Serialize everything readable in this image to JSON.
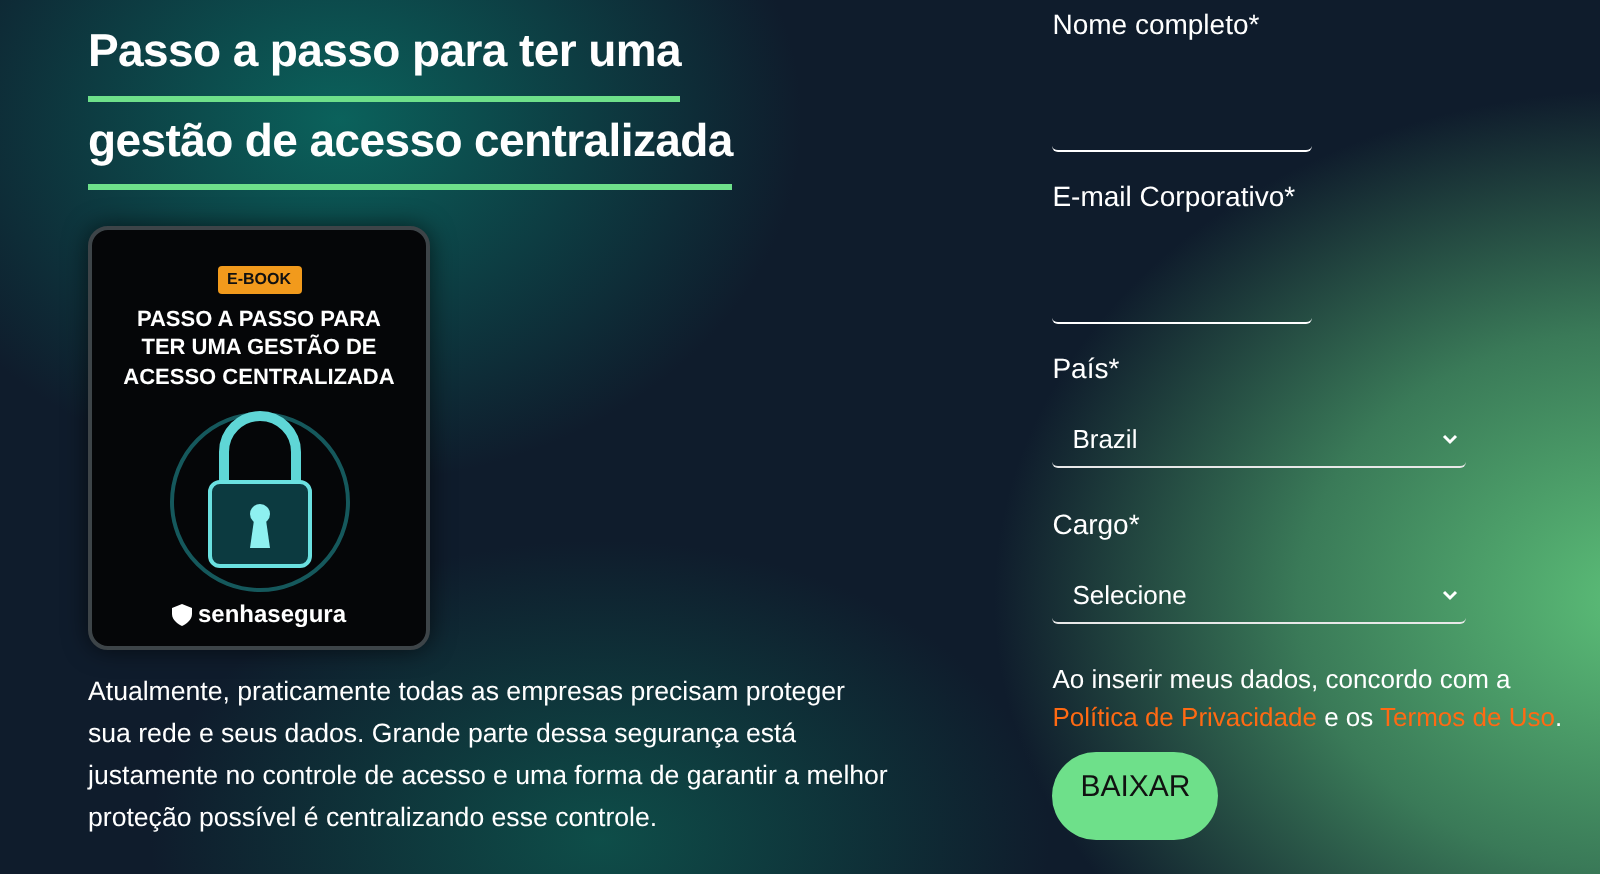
{
  "heading": {
    "lines": [
      "Passo a passo para ter uma",
      "gestão de acesso centralizada"
    ]
  },
  "ebook": {
    "badge": "E-BOOK",
    "title_lines": [
      "PASSO A PASSO PARA",
      "TER UMA GESTÃO DE",
      "ACESSO CENTRALIZADA"
    ],
    "brand": "senhasegura"
  },
  "intro": "Atualmente, praticamente todas as empresas precisam proteger sua rede e seus dados. Grande parte dessa segurança está justamente no controle de acesso e uma forma de garantir a melhor proteção possível é centralizando esse controle.",
  "form": {
    "fields": [
      {
        "kind": "text",
        "label": "Nome completo*"
      },
      {
        "kind": "text",
        "label": "E-mail Corporativo*"
      },
      {
        "kind": "select",
        "label": "País*",
        "value": "Brazil"
      },
      {
        "kind": "select",
        "label": "Cargo*",
        "value": "Selecione"
      }
    ],
    "consent": [
      {
        "kind": "text",
        "text": "Ao inserir meus dados, concordo com a "
      },
      {
        "kind": "link",
        "text": "Política de Privacidade"
      },
      {
        "kind": "text",
        "text": " e os "
      },
      {
        "kind": "link",
        "text": "Termos de Uso"
      },
      {
        "kind": "text",
        "text": "."
      }
    ],
    "submit": "BAIXAR"
  }
}
